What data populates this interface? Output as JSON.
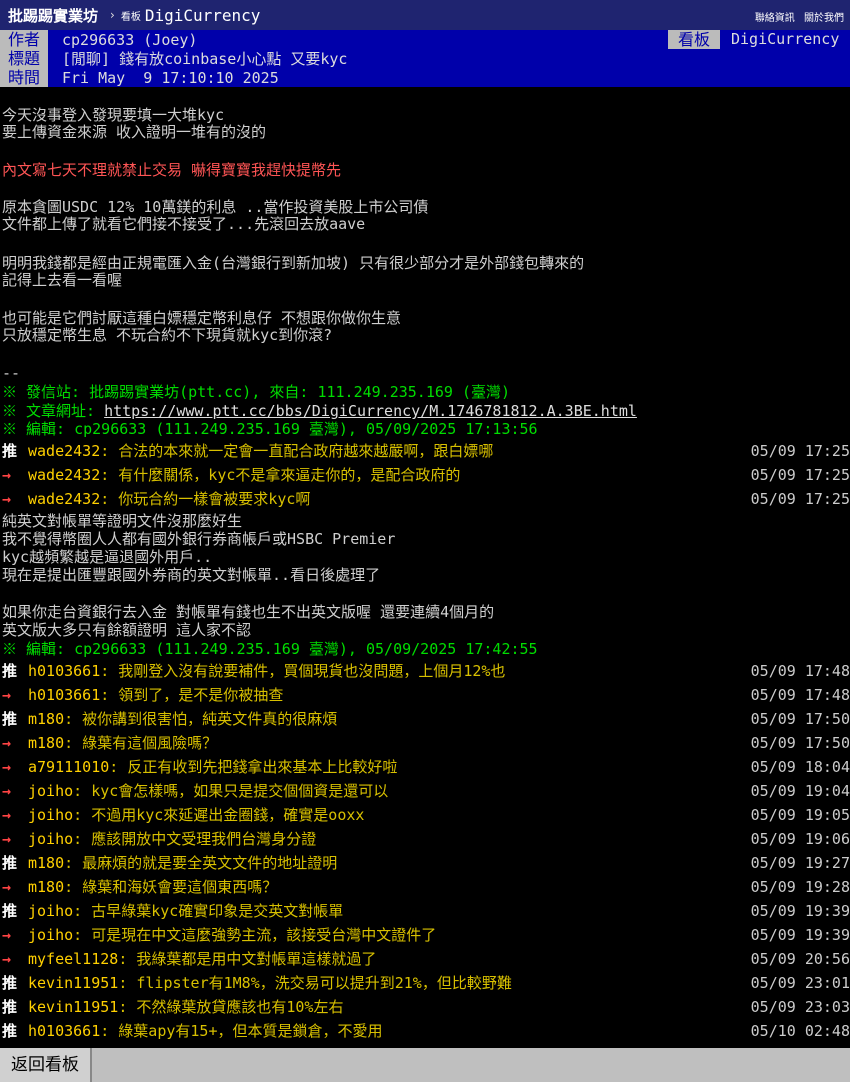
{
  "topbar": {
    "board_name": "批踢踢實業坊",
    "separator": "›",
    "kanban_label": "看板",
    "board": "DigiCurrency",
    "contact": "聯絡資訊",
    "about": "關於我們"
  },
  "header": {
    "author_tag": "作者",
    "author": "cp296633 (Joey)",
    "board_tag": "看板",
    "board": "DigiCurrency",
    "title_tag": "標題",
    "title": "[閒聊] 錢有放coinbase小心點 又要kyc",
    "time_tag": "時間",
    "time": "Fri May  9 17:10:10 2025"
  },
  "body": {
    "p1_l1": "今天沒事登入發現要填一大堆kyc",
    "p1_l2": "要上傳資金來源 收入證明一堆有的沒的",
    "p2_red": "內文寫七天不理就禁止交易 嚇得寶寶我趕快提幣先",
    "p3_l1": "原本貪圖USDC 12% 10萬鎂的利息 ..當作投資美股上市公司債",
    "p3_l2": "文件都上傳了就看它們接不接受了...先滾回去放aave",
    "p4_l1": "明明我錢都是經由正規電匯入金(台灣銀行到新加坡) 只有很少部分才是外部錢包轉來的",
    "p4_l2": "記得上去看一看喔",
    "p5_l1": "也可能是它們討厭這種白嫖穩定幣利息仔 不想跟你做你生意",
    "p5_l2": "只放穩定幣生息 不玩合約不下現貨就kyc到你滾?",
    "sig": "--",
    "source_line": "※ 發信站: 批踢踢實業坊(ptt.cc), 來自: 111.249.235.169 (臺灣)",
    "url_prefix": "※ 文章網址: ",
    "url": "https://www.ptt.cc/bbs/DigiCurrency/M.1746781812.A.3BE.html",
    "edit1": "※ 編輯: cp296633 (111.249.235.169 臺灣), 05/09/2025 17:13:56",
    "mid_l1": "純英文對帳單等證明文件沒那麼好生",
    "mid_l2": "我不覺得幣圈人人都有國外銀行券商帳戶或HSBC Premier",
    "mid_l3": "kyc越頻繁越是逼退國外用戶..",
    "mid_l4": "現在是提出匯豐跟國外券商的英文對帳單..看日後處理了",
    "mid_l5": "如果你走台資銀行去入金 對帳單有錢也生不出英文版喔 還要連續4個月的",
    "mid_l6": "英文版大多只有餘額證明 這人家不認",
    "edit2": "※ 編輯: cp296633 (111.249.235.169 臺灣), 05/09/2025 17:42:55"
  },
  "pushes_a": [
    {
      "tag": "推",
      "user": "wade2432",
      "text": ": 合法的本來就一定會一直配合政府越來越嚴啊，跟白嫖哪",
      "time": "05/09 17:25"
    },
    {
      "tag": "→",
      "user": "wade2432",
      "text": ": 有什麼關係，kyc不是拿來逼走你的，是配合政府的",
      "time": "05/09 17:25"
    },
    {
      "tag": "→",
      "user": "wade2432",
      "text": ": 你玩合約一樣會被要求kyc啊",
      "time": "05/09 17:25"
    }
  ],
  "pushes_b": [
    {
      "tag": "推",
      "user": "h0103661",
      "text": ": 我剛登入沒有說要補件，買個現貨也沒問題，上個月12%也",
      "time": "05/09 17:48"
    },
    {
      "tag": "→",
      "user": "h0103661",
      "text": ": 領到了，是不是你被抽查",
      "time": "05/09 17:48"
    },
    {
      "tag": "推",
      "user": "m180",
      "text": ": 被你講到很害怕，純英文件真的很麻煩",
      "time": "05/09 17:50"
    },
    {
      "tag": "→",
      "user": "m180",
      "text": ": 綠葉有這個風險嗎？",
      "time": "05/09 17:50"
    },
    {
      "tag": "→",
      "user": "a79111010",
      "text": ": 反正有收到先把錢拿出來基本上比較好啦",
      "time": "05/09 18:04"
    },
    {
      "tag": "→",
      "user": "joiho",
      "text": ": kyc會怎樣嗎，如果只是提交個個資是還可以",
      "time": "05/09 19:04"
    },
    {
      "tag": "→",
      "user": "joiho",
      "text": ": 不過用kyc來延遲出金圈錢，確實是ooxx",
      "time": "05/09 19:05"
    },
    {
      "tag": "→",
      "user": "joiho",
      "text": ": 應該開放中文受理我們台灣身分證",
      "time": "05/09 19:06"
    },
    {
      "tag": "推",
      "user": "m180",
      "text": ": 最麻煩的就是要全英文文件的地址證明",
      "time": "05/09 19:27"
    },
    {
      "tag": "→",
      "user": "m180",
      "text": ": 綠葉和海妖會要這個東西嗎？",
      "time": "05/09 19:28"
    },
    {
      "tag": "推",
      "user": "joiho",
      "text": ": 古早綠葉kyc確實印象是交英文對帳單",
      "time": "05/09 19:39"
    },
    {
      "tag": "→",
      "user": "joiho",
      "text": ": 可是現在中文這麼強勢主流，該接受台灣中文證件了",
      "time": "05/09 19:39"
    },
    {
      "tag": "→",
      "user": "myfeel1128",
      "text": ": 我綠葉都是用中文對帳單這樣就過了",
      "time": "05/09 20:56"
    },
    {
      "tag": "推",
      "user": "kevin11951",
      "text": ": flipster有1M8%，洗交易可以提升到21%，但比較野難",
      "time": "05/09 23:01"
    },
    {
      "tag": "推",
      "user": "kevin11951",
      "text": ": 不然綠葉放貸應該也有10%左右",
      "time": "05/09 23:03"
    },
    {
      "tag": "推",
      "user": "h0103661",
      "text": ": 綠葉apy有15+，但本質是鎖倉，不愛用",
      "time": "05/10 02:48"
    }
  ],
  "bottom": {
    "back_label": "返回看板"
  }
}
